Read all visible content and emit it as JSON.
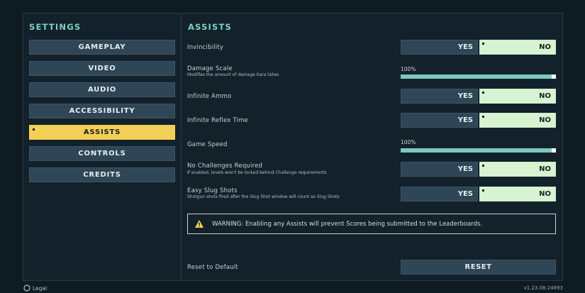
{
  "sidebar": {
    "heading": "SETTINGS",
    "items": [
      {
        "label": "GAMEPLAY"
      },
      {
        "label": "VIDEO"
      },
      {
        "label": "AUDIO"
      },
      {
        "label": "ACCESSIBILITY"
      },
      {
        "label": "ASSISTS",
        "active": true
      },
      {
        "label": "CONTROLS"
      },
      {
        "label": "CREDITS"
      }
    ]
  },
  "main": {
    "heading": "ASSISTS",
    "options": {
      "invincibility": {
        "label": "Invincibility",
        "yes": "YES",
        "no": "NO",
        "selected": "NO"
      },
      "damage_scale": {
        "label": "Damage Scale",
        "description": "Modifies the amount of damage Kara takes",
        "value_text": "100%",
        "value": 100
      },
      "infinite_ammo": {
        "label": "Infinite Ammo",
        "yes": "YES",
        "no": "NO",
        "selected": "NO"
      },
      "infinite_reflex": {
        "label": "Infinite Reflex Time",
        "yes": "YES",
        "no": "NO",
        "selected": "NO"
      },
      "game_speed": {
        "label": "Game Speed",
        "value_text": "100%",
        "value": 100
      },
      "no_challenges": {
        "label": "No Challenges Required",
        "description": "If enabled, levels won't be locked behind Challenge requirements",
        "yes": "YES",
        "no": "NO",
        "selected": "NO"
      },
      "easy_slug": {
        "label": "Easy Slug Shots",
        "description": "Shotgun shots fired after the Slug Shot window will count as Slug Shots",
        "yes": "YES",
        "no": "NO",
        "selected": "NO"
      }
    },
    "warning": "WARNING: Enabling any Assists will prevent Scores being submitted to the Leaderboards.",
    "reset_label": "Reset to Default",
    "reset_button": "RESET"
  },
  "footer": {
    "legal": "Legal",
    "version": "v1.23.08.24693"
  },
  "colors": {
    "background": "#0f1b22",
    "accent_heading": "#7fd1c2",
    "active_nav": "#f3cf57",
    "toggle_selected": "#d8f3d1",
    "button": "#2f4656",
    "slider_fill": "#7fc8bd"
  },
  "icons": {
    "warning": "warning-triangle-icon",
    "legal": "circle-icon"
  }
}
